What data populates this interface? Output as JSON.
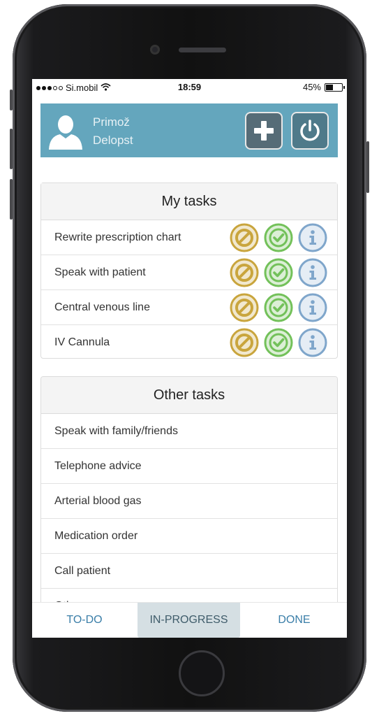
{
  "status_bar": {
    "carrier": "Si.mobil",
    "time": "18:59",
    "battery": "45%",
    "battery_level": 0.45,
    "wifi_icon": "wifi-icon"
  },
  "header": {
    "user_first": "Primož",
    "user_last": "Delopst",
    "avatar_icon": "user-avatar-icon",
    "add_icon": "plus-icon",
    "logout_icon": "power-icon",
    "bg_color": "#64a6bd"
  },
  "my_tasks": {
    "title": "My tasks",
    "items": [
      {
        "label": "Rewrite prescription chart"
      },
      {
        "label": "Speak with patient"
      },
      {
        "label": "Central venous line"
      },
      {
        "label": "IV Cannula"
      }
    ],
    "action_icons": [
      "cancel-icon",
      "check-icon",
      "info-icon"
    ],
    "action_colors": {
      "cancel": "#c9a53d",
      "check": "#73c15a",
      "info": "#7fa6cb"
    }
  },
  "other_tasks": {
    "title": "Other tasks",
    "items": [
      {
        "label": "Speak with family/friends"
      },
      {
        "label": "Telephone advice"
      },
      {
        "label": "Arterial blood gas"
      },
      {
        "label": "Medication order"
      },
      {
        "label": "Call patient"
      },
      {
        "label": "Other"
      }
    ]
  },
  "tabs": {
    "todo": "TO-DO",
    "in_progress": "IN-PROGRESS",
    "done": "DONE",
    "active": "in_progress"
  }
}
